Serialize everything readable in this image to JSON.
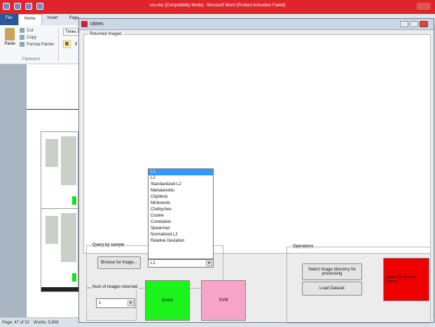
{
  "word": {
    "title": "xxx.doc [Compatibility Mode] - Microsoft Word (Product Activation Failed)",
    "tabs": [
      "File",
      "Home",
      "Insert",
      "Page"
    ],
    "clipboard": {
      "paste": "Paste",
      "cut": "Cut",
      "copy": "Copy",
      "format_painter": "Format Painter",
      "group_label": "Clipboard"
    },
    "font_name": "Times New",
    "bold": "B",
    "italic": "I",
    "status": {
      "page": "Page: 47 of 52",
      "words": "Words: 5,608"
    }
  },
  "figure": {
    "title": "cbires",
    "returned_images": "Returned Images",
    "query_by_sample": "Query by sample",
    "browse_button": "Browse for image...",
    "distance_selected": "L1",
    "distance_options": [
      "L1",
      "L2",
      "Standardized L2",
      "Mahalanobis",
      "Cityblock",
      "Minkowski",
      "Chebychev",
      "Cosine",
      "Correlation",
      "Spearman",
      "Normalized L2",
      "Relative Deviation"
    ],
    "num_images_label": "Num of images returned",
    "num_images_value": "1",
    "query_button": "Query",
    "svm_button": "SVM",
    "operations_label": "Operations",
    "select_dir_button": "Select image directory for processing",
    "load_dataset_button": "Load Dataset",
    "create_db_button": "Create DB of image features"
  },
  "colors": {
    "query": "#1cf41c",
    "svm": "#f6a5c8",
    "create_db": "#ee0000",
    "word_titlebar": "#e0242b"
  }
}
